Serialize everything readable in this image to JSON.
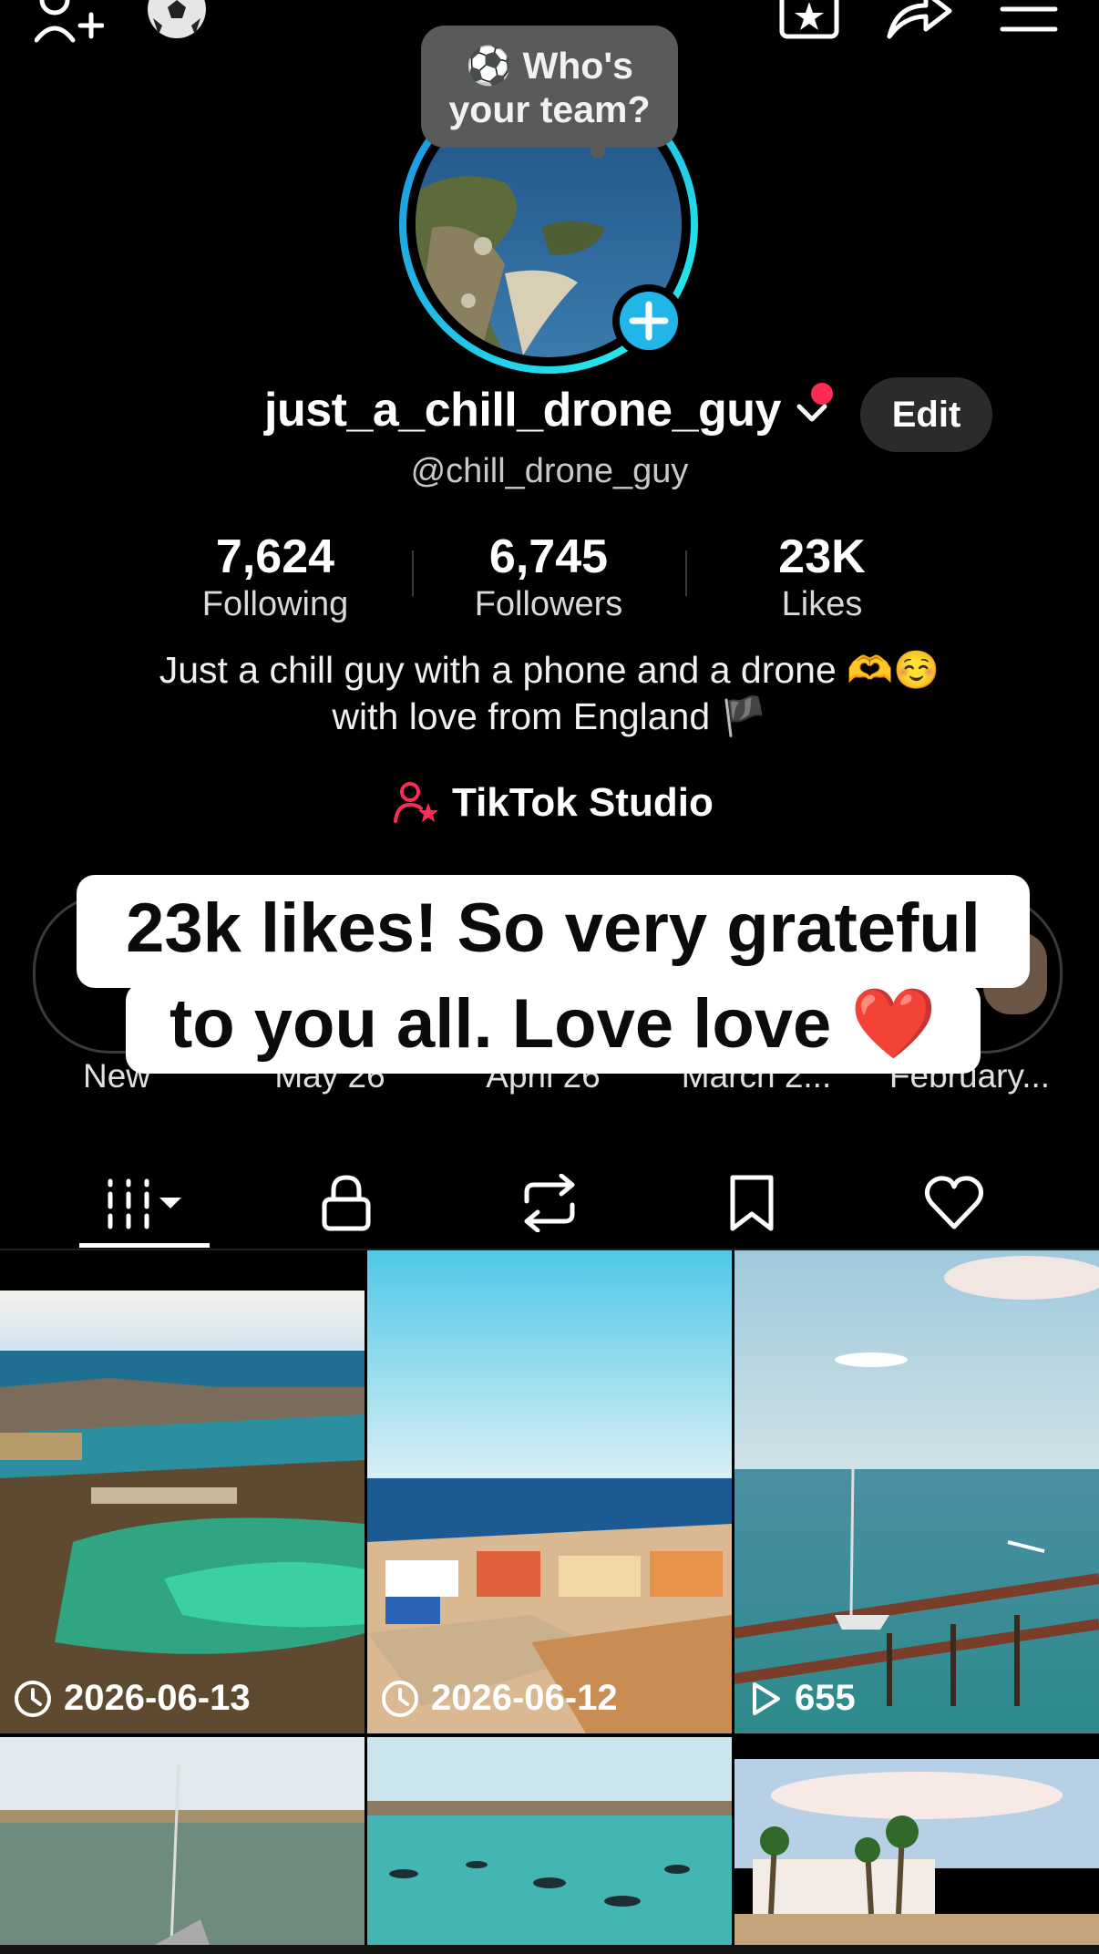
{
  "header": {
    "add_friend_icon": "person-plus-icon",
    "team_icon": "soccer-ball-icon",
    "favorites_icon": "star-box-icon",
    "share_icon": "share-arrow-icon",
    "menu_icon": "hamburger-menu-icon"
  },
  "team_prompt": {
    "icon": "⚽",
    "line1": "Who's",
    "line2": "your team?"
  },
  "profile": {
    "display_name": "just_a_chill_drone_guy",
    "handle": "@chill_drone_guy",
    "edit_label": "Edit"
  },
  "stats": [
    {
      "value": "7,624",
      "label": "Following"
    },
    {
      "value": "6,745",
      "label": "Followers"
    },
    {
      "value": "23K",
      "label": "Likes"
    }
  ],
  "bio": {
    "line1": "Just a chill guy with a phone and a drone 🫶☺️",
    "line2": "with love from England 🏴"
  },
  "studio": {
    "label": "TikTok Studio"
  },
  "stories": [
    {
      "label": "New"
    },
    {
      "label": "May 26"
    },
    {
      "label": "April 26"
    },
    {
      "label": "March 2..."
    },
    {
      "label": "February..."
    }
  ],
  "caption_overlay": {
    "line1": "23k likes! So very grateful",
    "line2": "to you all. Love love ❤️"
  },
  "tabs": [
    {
      "icon": "grid-icon",
      "active": true
    },
    {
      "icon": "lock-icon",
      "active": false
    },
    {
      "icon": "repost-icon",
      "active": false
    },
    {
      "icon": "bookmark-icon",
      "active": false
    },
    {
      "icon": "heart-icon",
      "active": false
    }
  ],
  "videos": [
    {
      "label": "2026-06-13",
      "badge": "clock-icon"
    },
    {
      "label": "2026-06-12",
      "badge": "clock-icon"
    },
    {
      "label": "655",
      "badge": "play-icon"
    },
    {
      "label": "",
      "badge": ""
    },
    {
      "label": "",
      "badge": ""
    },
    {
      "label": "",
      "badge": ""
    }
  ],
  "colors": {
    "background": "#000000",
    "accent_pink": "#fe2c55",
    "accent_cyan": "#25f4ee",
    "plus_badge": "#20b6e8"
  }
}
